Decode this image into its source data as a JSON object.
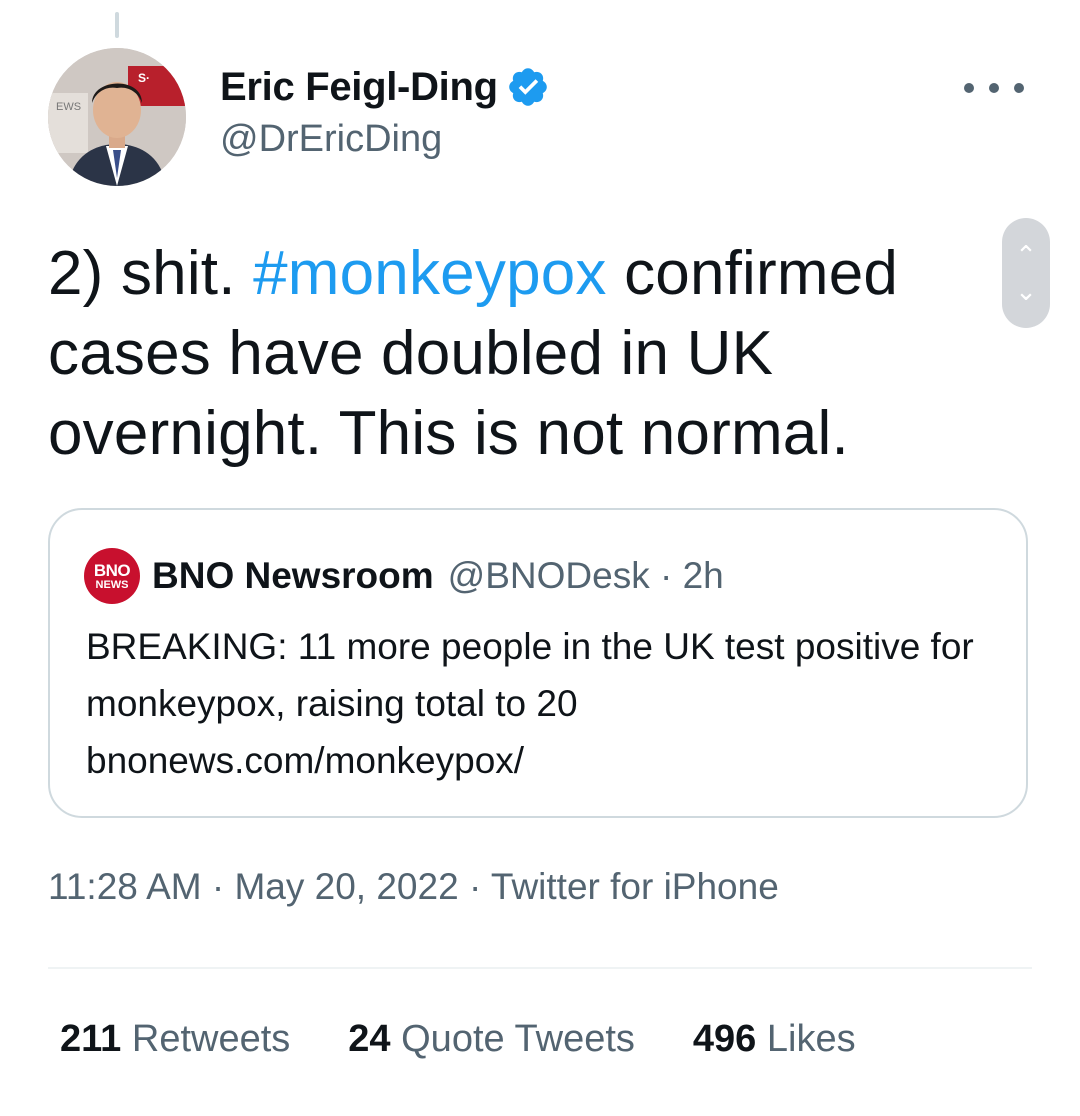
{
  "author": {
    "display_name": "Eric Feigl-Ding",
    "handle": "@DrEricDing",
    "verified_icon": "verified-badge-icon",
    "avatar_text": [
      "EWS",
      "S·"
    ]
  },
  "tweet": {
    "text_before": "2) shit. ",
    "hashtag": "#monkeypox",
    "text_after": " confirmed cases have doubled in UK overnight.  This is not normal."
  },
  "quoted_tweet": {
    "logo_line1": "BNO",
    "logo_line2": "NEWS",
    "display_name": "BNO Newsroom",
    "meta": "@BNODesk · 2h",
    "text": "BREAKING: 11 more people in the UK test positive for monkeypox, raising total to 20 bnonews.com/monkeypox/"
  },
  "timestamp_line": "11:28 AM · May 20, 2022 · Twitter for iPhone",
  "stats": [
    {
      "number": "211",
      "label": "Retweets"
    },
    {
      "number": "24",
      "label": "Quote Tweets"
    },
    {
      "number": "496",
      "label": "Likes"
    }
  ],
  "colors": {
    "accent": "#1d9bf0",
    "secondary_text": "#536471",
    "bno_red": "#c8102e"
  }
}
